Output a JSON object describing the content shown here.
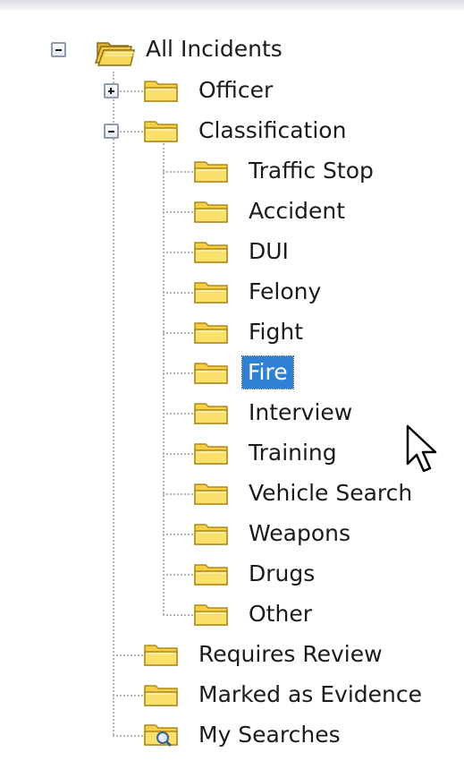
{
  "tree": {
    "root": {
      "label": "All Incidents",
      "icon": "folder-stack-icon",
      "expanded": true
    },
    "officer": {
      "label": "Officer",
      "icon": "folder-icon",
      "expanded": false
    },
    "classification": {
      "label": "Classification",
      "icon": "folder-icon",
      "expanded": true,
      "children": [
        {
          "label": "Traffic Stop"
        },
        {
          "label": "Accident"
        },
        {
          "label": "DUI"
        },
        {
          "label": "Felony"
        },
        {
          "label": "Fight"
        },
        {
          "label": "Fire",
          "selected": true
        },
        {
          "label": "Interview"
        },
        {
          "label": "Training"
        },
        {
          "label": "Vehicle Search"
        },
        {
          "label": "Weapons"
        },
        {
          "label": "Drugs"
        },
        {
          "label": "Other"
        }
      ]
    },
    "requires_review": {
      "label": "Requires Review",
      "icon": "folder-icon"
    },
    "marked_as_evidence": {
      "label": "Marked as Evidence",
      "icon": "folder-icon"
    },
    "my_searches": {
      "label": "My Searches",
      "icon": "search-folder-icon"
    }
  },
  "colors": {
    "selection": "#2f7fd3",
    "folder_fill": "#f7cf45",
    "folder_edge": "#b08a1c",
    "tree_line": "#b5b5b5"
  }
}
